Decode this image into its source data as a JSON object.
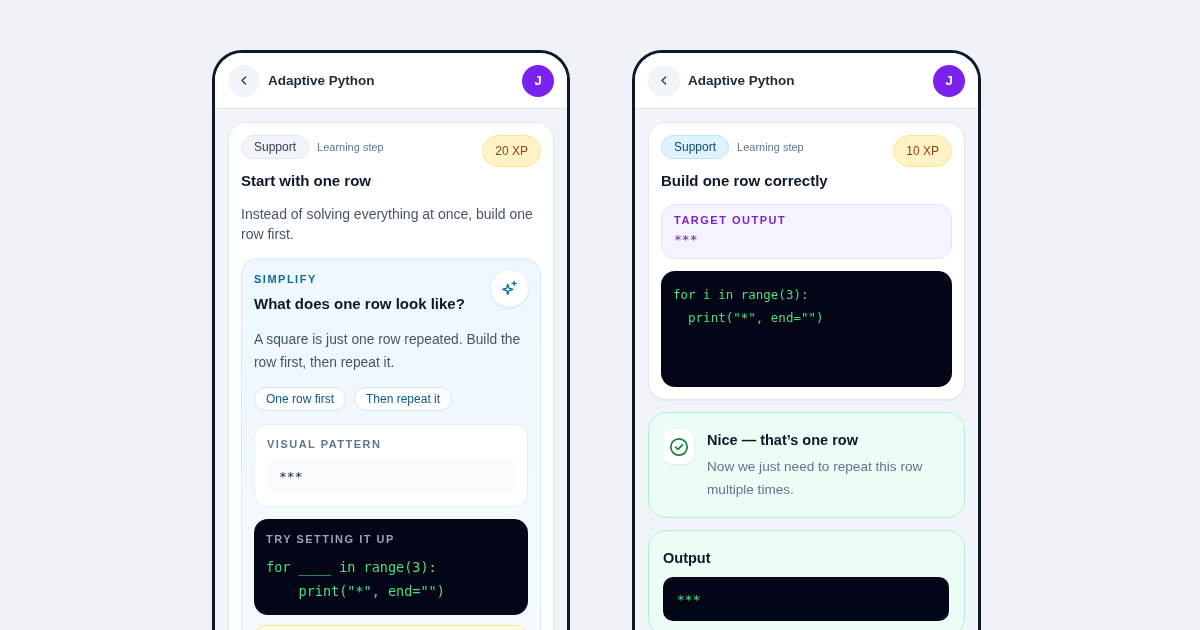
{
  "phones": [
    {
      "header": {
        "title": "Adaptive Python",
        "avatar": "J"
      },
      "cards": [
        {
          "kind": "step",
          "tag": {
            "label": "Support",
            "highlighted": false
          },
          "step_label": "Learning step",
          "xp": "20 XP",
          "title": "Start with one row",
          "blocks": [
            {
              "kind": "text",
              "text": "Instead of solving everything at once, build one row first."
            },
            {
              "kind": "simplify",
              "eyebrow": "SIMPLIFY",
              "title": "What does one row look like?",
              "text": "A square is just one row repeated. Build the row first, then repeat it.",
              "chips": [
                "One row first",
                "Then repeat it"
              ],
              "blocks": [
                {
                  "kind": "pattern",
                  "label": "VISUAL PATTERN",
                  "value": "***"
                },
                {
                  "kind": "code",
                  "label": "TRY SETTING IT UP",
                  "lines": [
                    "for ____ in range(3):",
                    "    print(\"*\", end=\"\")"
                  ]
                },
                {
                  "kind": "hint"
                }
              ]
            }
          ]
        }
      ]
    },
    {
      "header": {
        "title": "Adaptive Python",
        "avatar": "J"
      },
      "cards": [
        {
          "kind": "step",
          "tag": {
            "label": "Support",
            "highlighted": true
          },
          "step_label": "Learning step",
          "xp": "10 XP",
          "title": "Build one row correctly",
          "blocks": [
            {
              "kind": "target",
              "label": "TARGET OUTPUT",
              "value": "***"
            },
            {
              "kind": "code",
              "lines": [
                "for i in range(3):",
                "  print(\"*\", end=\"\")"
              ]
            }
          ]
        },
        {
          "kind": "feedback",
          "title": "Nice — that’s one row",
          "text": "Now we just need to repeat this row multiple times."
        },
        {
          "kind": "output",
          "title": "Output",
          "value": "***"
        }
      ]
    }
  ]
}
